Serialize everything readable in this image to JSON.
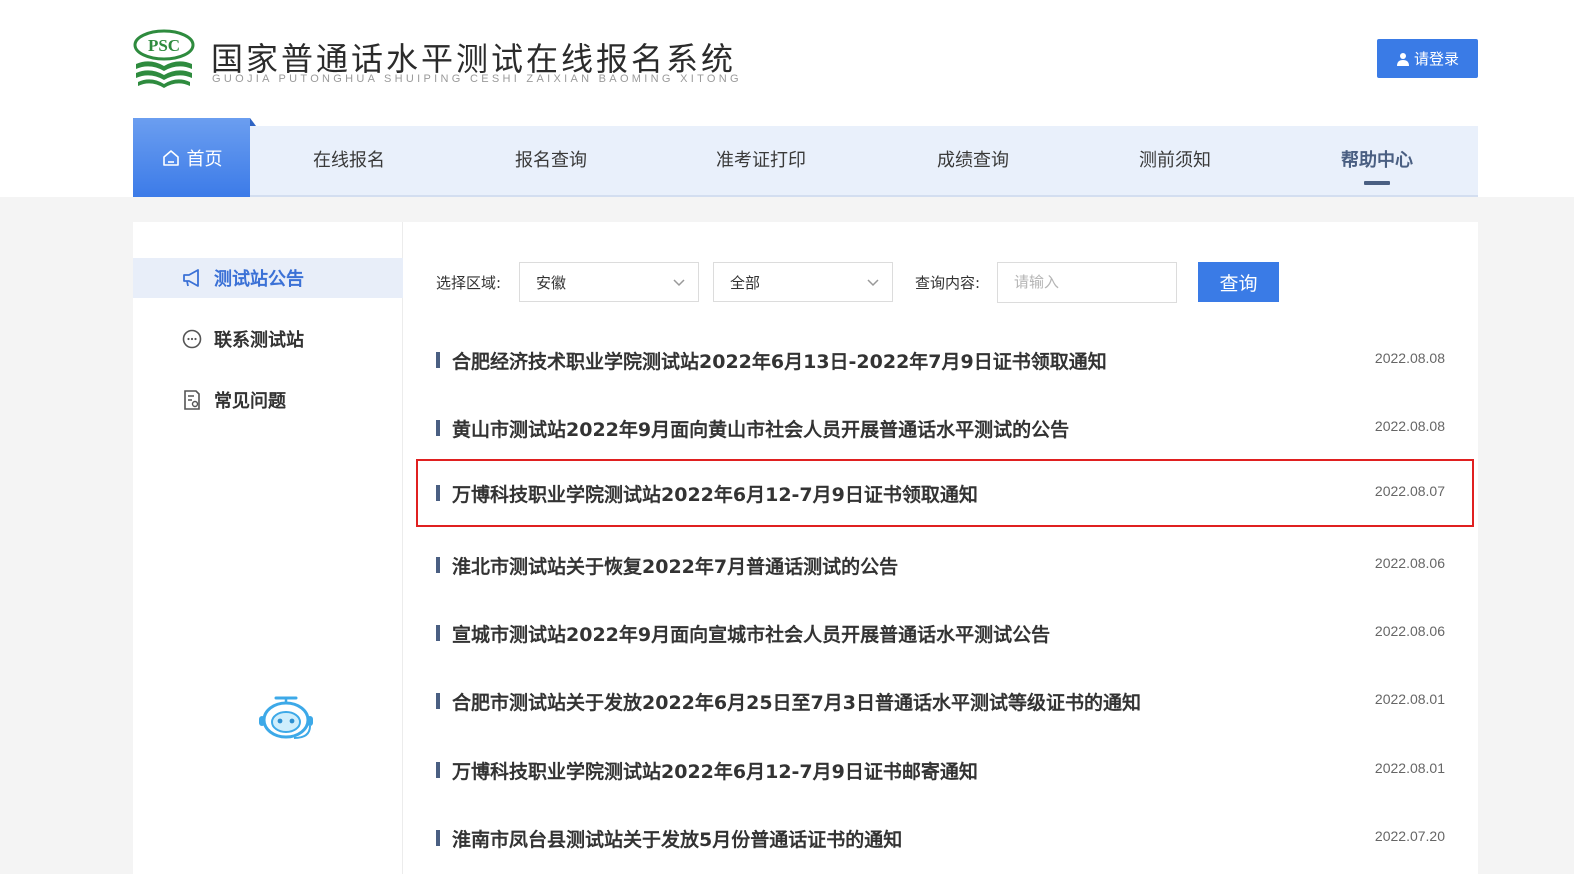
{
  "brand": {
    "logo_text": "PSC",
    "title": "国家普通话水平测试在线报名系统",
    "subtitle": "GUOJIA PUTONGHUA SHUIPING CESHI ZAIXIAN BAOMING XITONG"
  },
  "header": {
    "login_label": "请登录"
  },
  "nav": {
    "home": "首页",
    "items": [
      "在线报名",
      "报名查询",
      "准考证打印",
      "成绩查询",
      "测前须知",
      "帮助中心"
    ],
    "active": "帮助中心"
  },
  "sidebar": {
    "items": [
      {
        "label": "测试站公告",
        "icon": "megaphone-icon",
        "active": true
      },
      {
        "label": "联系测试站",
        "icon": "chat-icon",
        "active": false
      },
      {
        "label": "常见问题",
        "icon": "faq-document-icon",
        "active": false
      }
    ]
  },
  "filters": {
    "region_label": "选择区域:",
    "province": "安徽",
    "city": "全部",
    "content_label": "查询内容:",
    "search_placeholder": "请输入",
    "query_button": "查询"
  },
  "notices": [
    {
      "title": "合肥经济技术职业学院测试站2022年6月13日-2022年7月9日证书领取通知",
      "date": "2022.08.08"
    },
    {
      "title": "黄山市测试站2022年9月面向黄山市社会人员开展普通话水平测试的公告",
      "date": "2022.08.08"
    },
    {
      "title": "万博科技职业学院测试站2022年6月12-7月9日证书领取通知",
      "date": "2022.08.07"
    },
    {
      "title": "淮北市测试站关于恢复2022年7月普通话测试的公告",
      "date": "2022.08.06"
    },
    {
      "title": "宣城市测试站2022年9月面向宣城市社会人员开展普通话水平测试公告",
      "date": "2022.08.06"
    },
    {
      "title": "合肥市测试站关于发放2022年6月25日至7月3日普通话水平测试等级证书的通知",
      "date": "2022.08.01"
    },
    {
      "title": "万博科技职业学院测试站2022年6月12-7月9日证书邮寄通知",
      "date": "2022.08.01"
    },
    {
      "title": "淮南市凤台县测试站关于发放5月份普通话证书的通知",
      "date": "2022.07.20"
    }
  ],
  "highlighted_notice_index": 2,
  "colors": {
    "accent": "#3a7be6",
    "nav_bg": "#e9f0fb",
    "highlight_border": "#e02020"
  }
}
